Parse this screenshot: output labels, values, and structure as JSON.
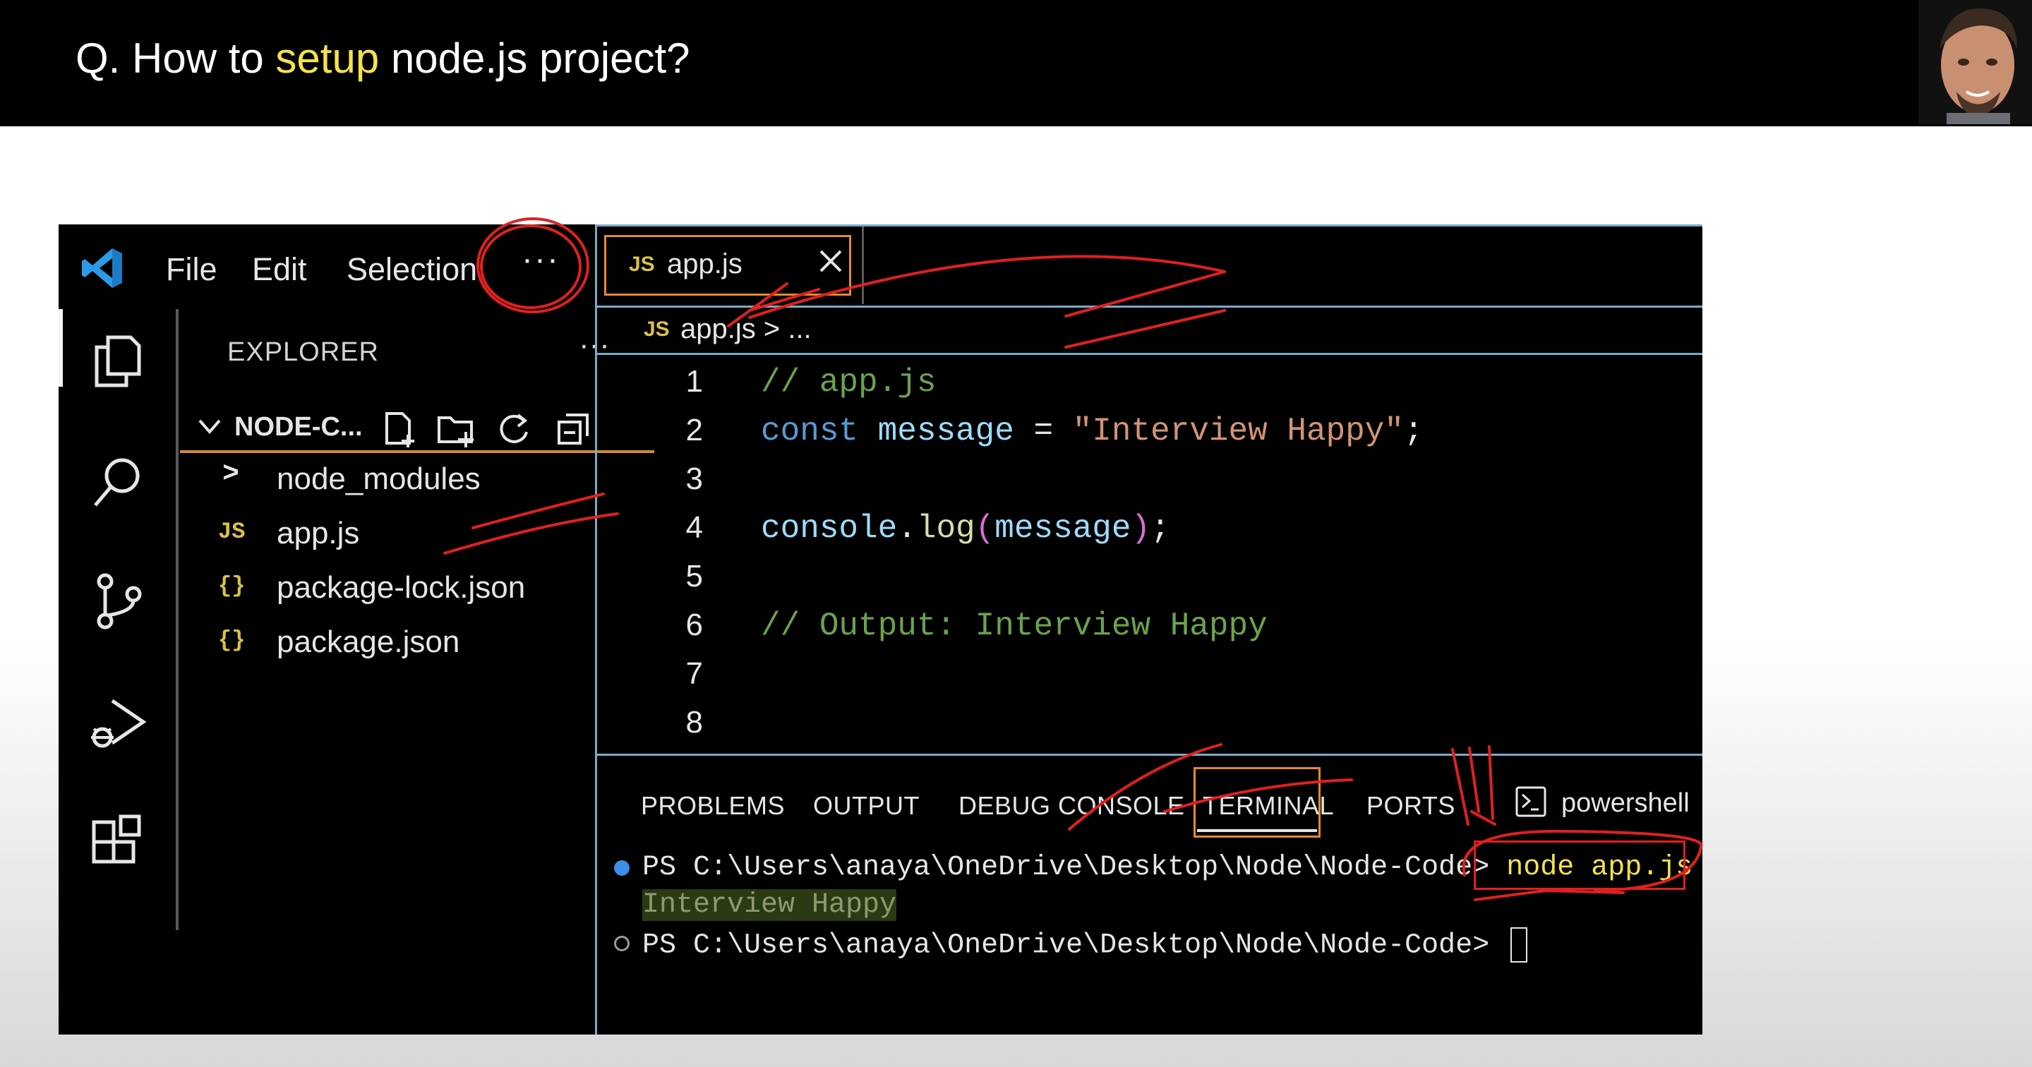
{
  "slide": {
    "title_prefix": "Q. How to ",
    "title_highlight": "setup",
    "title_suffix": " node.js project?",
    "highlight_color": "#f3e34a"
  },
  "menu": {
    "items": [
      "File",
      "Edit",
      "Selection"
    ],
    "more": "···"
  },
  "activity_bar": {
    "icons": [
      "explorer-files-icon",
      "search-icon",
      "source-control-icon",
      "run-debug-icon",
      "extensions-icon"
    ]
  },
  "explorer": {
    "title": "EXPLORER",
    "more": "···",
    "folder_name": "NODE-C...",
    "folder_actions": [
      "new-file-icon",
      "new-folder-icon",
      "refresh-icon",
      "collapse-all-icon"
    ],
    "files": [
      {
        "icon_text": ">",
        "icon": "chevron-right-icon",
        "label": "node_modules"
      },
      {
        "icon_text": "JS",
        "icon": "js-file-icon",
        "label": "app.js"
      },
      {
        "icon_text": "{}",
        "icon": "json-file-icon",
        "label": "package-lock.json"
      },
      {
        "icon_text": "{}",
        "icon": "json-file-icon",
        "label": "package.json"
      }
    ]
  },
  "editor": {
    "tab": {
      "badge": "JS",
      "name": "app.js"
    },
    "breadcrumb": {
      "badge": "JS",
      "path": "app.js > ..."
    },
    "lines": [
      {
        "n": "1",
        "text": "// app.js"
      },
      {
        "n": "2",
        "text": "const message = \"Interview Happy\";"
      },
      {
        "n": "3",
        "text": ""
      },
      {
        "n": "4",
        "text": "console.log(message);"
      },
      {
        "n": "5",
        "text": ""
      },
      {
        "n": "6",
        "text": "// Output: Interview Happy"
      },
      {
        "n": "7",
        "text": ""
      },
      {
        "n": "8",
        "text": ""
      }
    ]
  },
  "panel": {
    "tabs": [
      "PROBLEMS",
      "OUTPUT",
      "DEBUG CONSOLE",
      "TERMINAL",
      "PORTS"
    ],
    "active_tab": "TERMINAL",
    "shell": "powershell",
    "terminal": {
      "prompt1": "PS C:\\Users\\anaya\\OneDrive\\Desktop\\Node\\Node-Code>",
      "command": "node app.js",
      "output": "Interview Happy",
      "prompt2": "PS C:\\Users\\anaya\\OneDrive\\Desktop\\Node\\Node-Code>"
    }
  },
  "colors": {
    "accent_orange": "#e58a2c",
    "annotation_red": "#e02020",
    "js_yellow": "#d9c24a",
    "comment_green": "#6ba34e",
    "keyword_blue": "#569cd6"
  }
}
